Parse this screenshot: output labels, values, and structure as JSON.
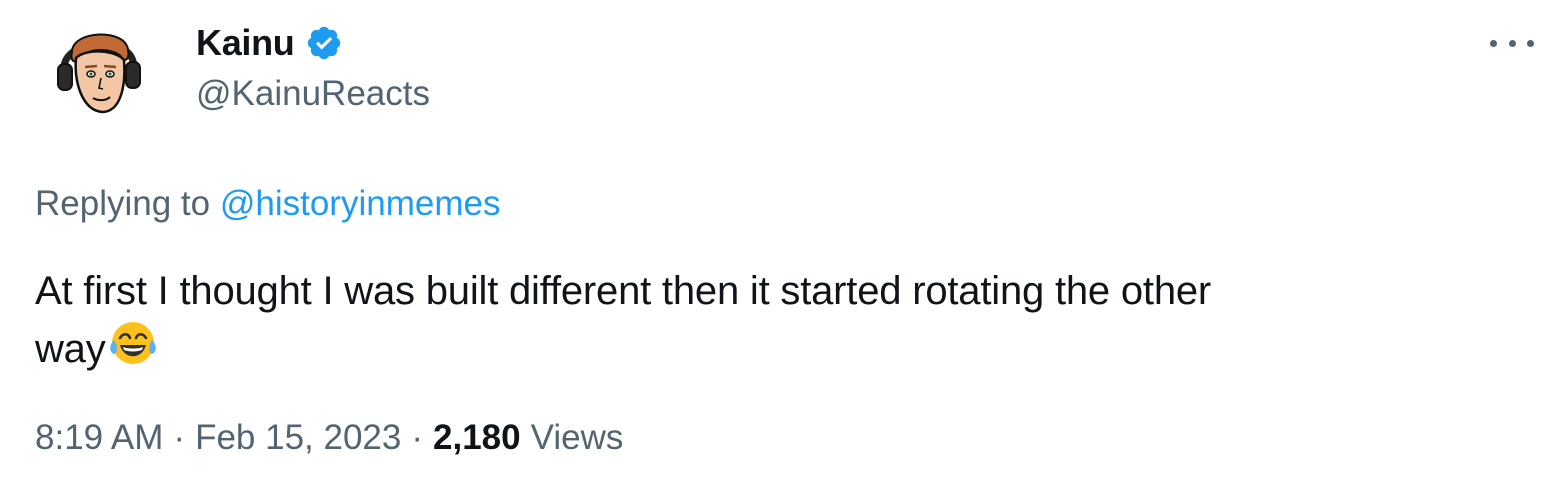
{
  "author": {
    "display_name": "Kainu",
    "handle": "@KainuReacts",
    "verified": true,
    "avatar": "cartoon-avatar-with-headset"
  },
  "tweet": {
    "replying_prefix": "Replying to",
    "replying_to": "@historyinmemes",
    "text_line1": "At first I thought I was built different then it started rotating the other",
    "text_line2": "way",
    "emoji": "face-with-tears-of-joy",
    "time": "8:19 AM",
    "separator": "·",
    "date": "Feb 15, 2023",
    "views_count": "2,180",
    "views_label": "Views"
  },
  "menu": {
    "icon": "more-horizontal-icon"
  },
  "colors": {
    "text_primary": "#0f1419",
    "text_secondary": "#536471",
    "link": "#1d9bf0",
    "verified_badge": "#1d9bf0"
  }
}
